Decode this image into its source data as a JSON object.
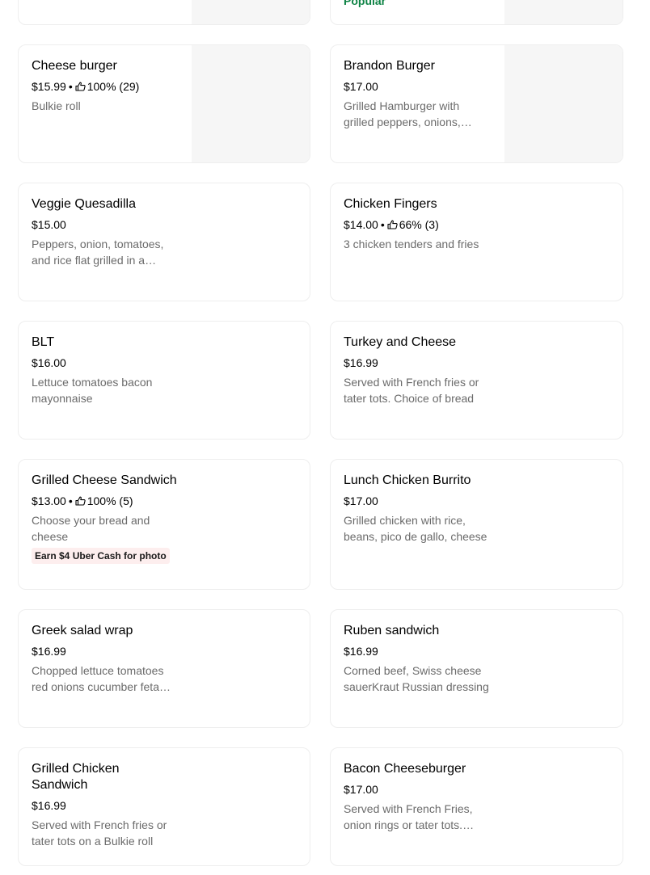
{
  "top_row": {
    "left": {},
    "right": {
      "badge": "Popular"
    }
  },
  "items": [
    {
      "name": "Cheese burger",
      "price": "$15.99",
      "rating": "100% (29)",
      "description": "Bulkie roll",
      "has_image": true
    },
    {
      "name": "Brandon Burger",
      "price": "$17.00",
      "description": "Grilled Hamburger with grilled peppers, onions, mushrooms",
      "has_image": true
    },
    {
      "name": "Veggie Quesadilla",
      "price": "$15.00",
      "description": "Peppers, onion, tomatoes, and rice flat grilled in a tortilla"
    },
    {
      "name": "Chicken Fingers",
      "price": "$14.00",
      "rating": "66% (3)",
      "description": "3 chicken tenders and fries"
    },
    {
      "name": "BLT",
      "price": "$16.00",
      "description": "Lettuce tomatoes bacon mayonnaise"
    },
    {
      "name": "Turkey and Cheese",
      "price": "$16.99",
      "description": "Served with French fries or tater tots. Choice of bread"
    },
    {
      "name": "Grilled Cheese Sandwich",
      "price": "$13.00",
      "rating": "100% (5)",
      "description": "Choose your bread and cheese",
      "promo": "Earn $4 Uber Cash for photo"
    },
    {
      "name": "Lunch Chicken Burrito",
      "price": "$17.00",
      "description": "Grilled chicken with rice, beans, pico de gallo, cheese"
    },
    {
      "name": "Greek salad wrap",
      "price": "$16.99",
      "description": "Chopped lettuce tomatoes red onions cucumber feta cheese"
    },
    {
      "name": "Ruben sandwich",
      "price": "$16.99",
      "description": "Corned beef, Swiss cheese sauerKraut Russian dressing"
    },
    {
      "name": "Grilled Chicken Sandwich",
      "price": "$16.99",
      "description": "Served with French fries or tater tots on a Bulkie roll"
    },
    {
      "name": "Bacon Cheeseburger",
      "price": "$17.00",
      "description": "Served with French Fries, onion rings or tater tots. Bulkie roll"
    }
  ],
  "meta_separator": "•",
  "icons": {
    "rating": "thumbs-up-icon"
  },
  "colors": {
    "popular": "#0e8345",
    "promo_bg": "#fdeeee",
    "description": "#6b6b6b",
    "image_placeholder": "#f6f6f6"
  }
}
